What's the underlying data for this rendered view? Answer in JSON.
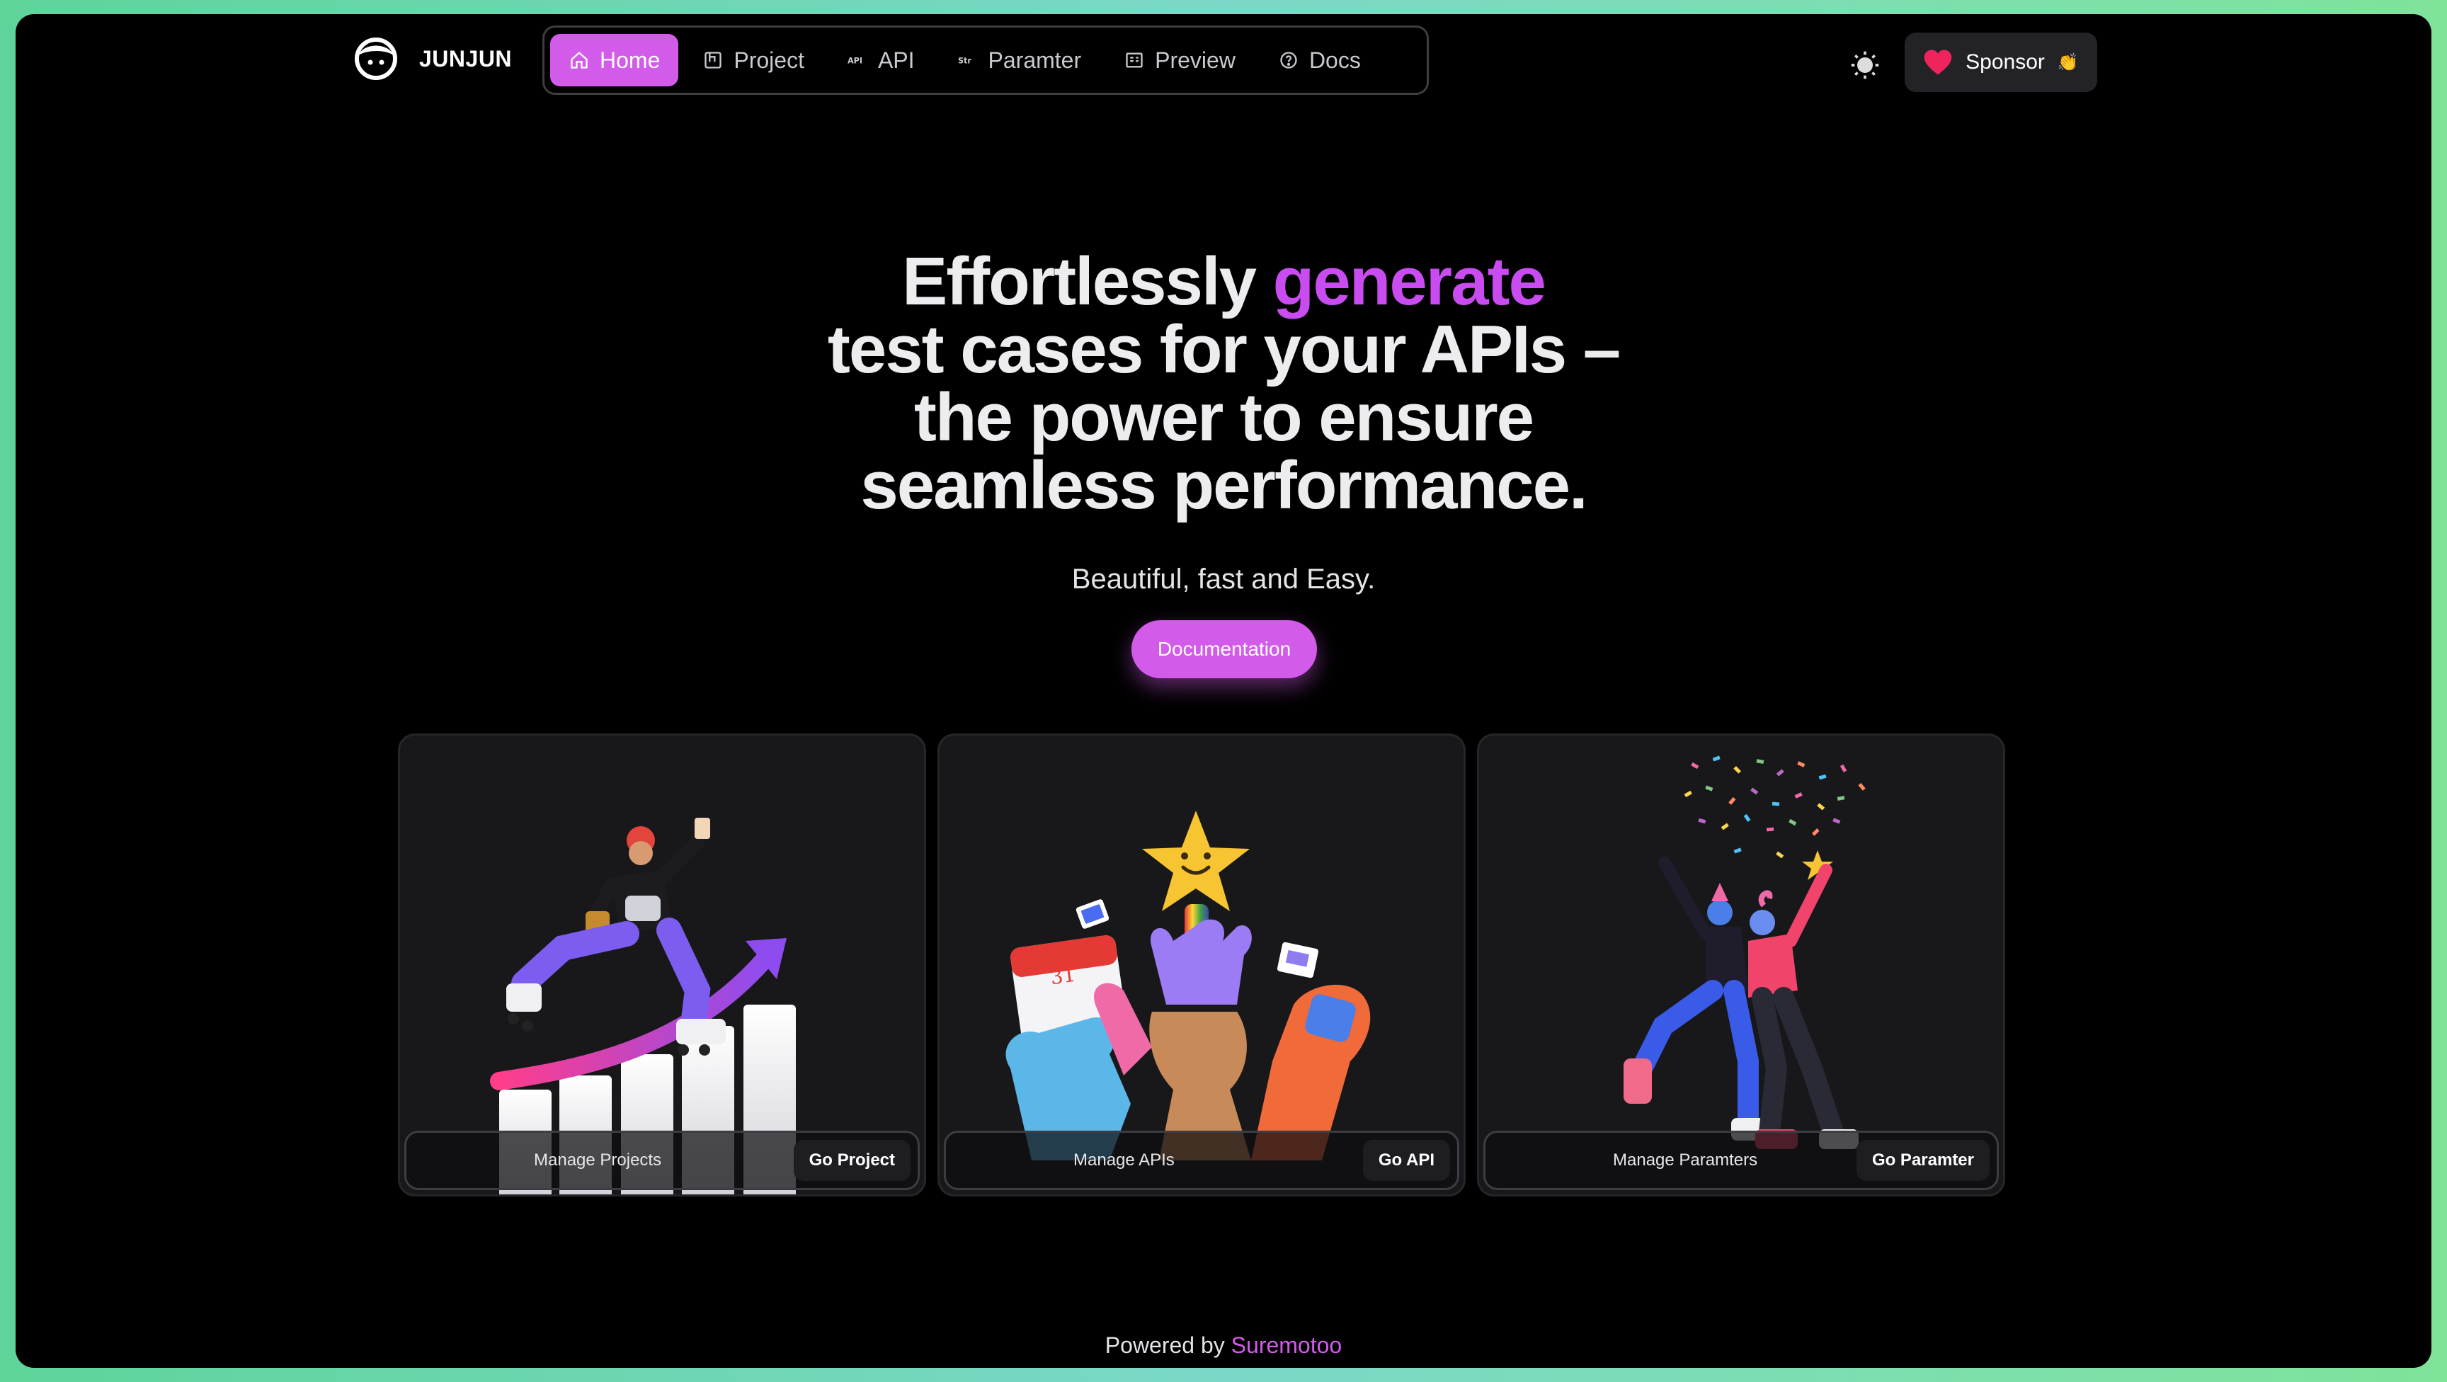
{
  "brand": {
    "name": "JUNJUN",
    "logo_icon": "face-icon"
  },
  "nav": {
    "items": [
      {
        "label": "Home",
        "icon": "home-icon",
        "active": true
      },
      {
        "label": "Project",
        "icon": "layout-icon",
        "active": false
      },
      {
        "label": "API",
        "icon": "api-icon",
        "active": false
      },
      {
        "label": "Paramter",
        "icon": "str-icon",
        "active": false
      },
      {
        "label": "Preview",
        "icon": "preview-icon",
        "active": false
      },
      {
        "label": "Docs",
        "icon": "help-circle-icon",
        "active": false
      }
    ]
  },
  "header": {
    "theme_icon": "sun-icon",
    "sponsor_label": "Sponsor",
    "sponsor_heart": "heart-icon",
    "sponsor_emoji": "👏"
  },
  "hero": {
    "title_part1": "Effortlessly",
    "title_accent": "generate",
    "title_line2": "test cases for your APIs –",
    "title_line3": "the power to ensure",
    "title_line4": "seamless performance.",
    "subtitle": "Beautiful, fast and Easy.",
    "cta_label": "Documentation"
  },
  "cards": [
    {
      "label": "Manage Projects",
      "button": "Go Project"
    },
    {
      "label": "Manage APIs",
      "button": "Go API"
    },
    {
      "label": "Manage Paramters",
      "button": "Go Paramter"
    }
  ],
  "footer": {
    "prefix": "Powered by",
    "link": "Suremotoo"
  },
  "colors": {
    "accent": "#d35bea",
    "accent_text": "#c84cf0",
    "background": "#000000",
    "card_bg": "#18181b"
  }
}
